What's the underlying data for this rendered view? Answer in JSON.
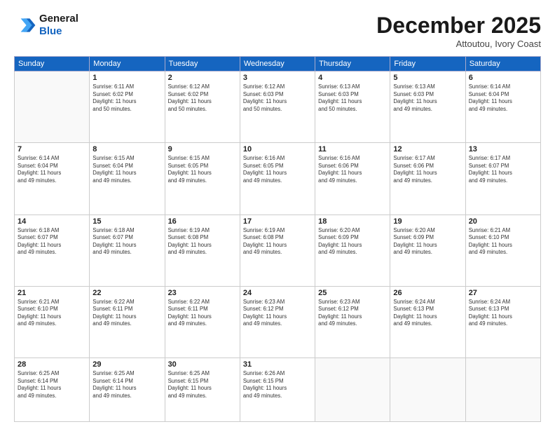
{
  "logo": {
    "line1": "General",
    "line2": "Blue"
  },
  "header": {
    "month": "December 2025",
    "location": "Attoutou, Ivory Coast"
  },
  "weekdays": [
    "Sunday",
    "Monday",
    "Tuesday",
    "Wednesday",
    "Thursday",
    "Friday",
    "Saturday"
  ],
  "weeks": [
    [
      {
        "day": "",
        "info": ""
      },
      {
        "day": "1",
        "info": "Sunrise: 6:11 AM\nSunset: 6:02 PM\nDaylight: 11 hours\nand 50 minutes."
      },
      {
        "day": "2",
        "info": "Sunrise: 6:12 AM\nSunset: 6:02 PM\nDaylight: 11 hours\nand 50 minutes."
      },
      {
        "day": "3",
        "info": "Sunrise: 6:12 AM\nSunset: 6:03 PM\nDaylight: 11 hours\nand 50 minutes."
      },
      {
        "day": "4",
        "info": "Sunrise: 6:13 AM\nSunset: 6:03 PM\nDaylight: 11 hours\nand 50 minutes."
      },
      {
        "day": "5",
        "info": "Sunrise: 6:13 AM\nSunset: 6:03 PM\nDaylight: 11 hours\nand 49 minutes."
      },
      {
        "day": "6",
        "info": "Sunrise: 6:14 AM\nSunset: 6:04 PM\nDaylight: 11 hours\nand 49 minutes."
      }
    ],
    [
      {
        "day": "7",
        "info": "Sunrise: 6:14 AM\nSunset: 6:04 PM\nDaylight: 11 hours\nand 49 minutes."
      },
      {
        "day": "8",
        "info": "Sunrise: 6:15 AM\nSunset: 6:04 PM\nDaylight: 11 hours\nand 49 minutes."
      },
      {
        "day": "9",
        "info": "Sunrise: 6:15 AM\nSunset: 6:05 PM\nDaylight: 11 hours\nand 49 minutes."
      },
      {
        "day": "10",
        "info": "Sunrise: 6:16 AM\nSunset: 6:05 PM\nDaylight: 11 hours\nand 49 minutes."
      },
      {
        "day": "11",
        "info": "Sunrise: 6:16 AM\nSunset: 6:06 PM\nDaylight: 11 hours\nand 49 minutes."
      },
      {
        "day": "12",
        "info": "Sunrise: 6:17 AM\nSunset: 6:06 PM\nDaylight: 11 hours\nand 49 minutes."
      },
      {
        "day": "13",
        "info": "Sunrise: 6:17 AM\nSunset: 6:07 PM\nDaylight: 11 hours\nand 49 minutes."
      }
    ],
    [
      {
        "day": "14",
        "info": "Sunrise: 6:18 AM\nSunset: 6:07 PM\nDaylight: 11 hours\nand 49 minutes."
      },
      {
        "day": "15",
        "info": "Sunrise: 6:18 AM\nSunset: 6:07 PM\nDaylight: 11 hours\nand 49 minutes."
      },
      {
        "day": "16",
        "info": "Sunrise: 6:19 AM\nSunset: 6:08 PM\nDaylight: 11 hours\nand 49 minutes."
      },
      {
        "day": "17",
        "info": "Sunrise: 6:19 AM\nSunset: 6:08 PM\nDaylight: 11 hours\nand 49 minutes."
      },
      {
        "day": "18",
        "info": "Sunrise: 6:20 AM\nSunset: 6:09 PM\nDaylight: 11 hours\nand 49 minutes."
      },
      {
        "day": "19",
        "info": "Sunrise: 6:20 AM\nSunset: 6:09 PM\nDaylight: 11 hours\nand 49 minutes."
      },
      {
        "day": "20",
        "info": "Sunrise: 6:21 AM\nSunset: 6:10 PM\nDaylight: 11 hours\nand 49 minutes."
      }
    ],
    [
      {
        "day": "21",
        "info": "Sunrise: 6:21 AM\nSunset: 6:10 PM\nDaylight: 11 hours\nand 49 minutes."
      },
      {
        "day": "22",
        "info": "Sunrise: 6:22 AM\nSunset: 6:11 PM\nDaylight: 11 hours\nand 49 minutes."
      },
      {
        "day": "23",
        "info": "Sunrise: 6:22 AM\nSunset: 6:11 PM\nDaylight: 11 hours\nand 49 minutes."
      },
      {
        "day": "24",
        "info": "Sunrise: 6:23 AM\nSunset: 6:12 PM\nDaylight: 11 hours\nand 49 minutes."
      },
      {
        "day": "25",
        "info": "Sunrise: 6:23 AM\nSunset: 6:12 PM\nDaylight: 11 hours\nand 49 minutes."
      },
      {
        "day": "26",
        "info": "Sunrise: 6:24 AM\nSunset: 6:13 PM\nDaylight: 11 hours\nand 49 minutes."
      },
      {
        "day": "27",
        "info": "Sunrise: 6:24 AM\nSunset: 6:13 PM\nDaylight: 11 hours\nand 49 minutes."
      }
    ],
    [
      {
        "day": "28",
        "info": "Sunrise: 6:25 AM\nSunset: 6:14 PM\nDaylight: 11 hours\nand 49 minutes."
      },
      {
        "day": "29",
        "info": "Sunrise: 6:25 AM\nSunset: 6:14 PM\nDaylight: 11 hours\nand 49 minutes."
      },
      {
        "day": "30",
        "info": "Sunrise: 6:25 AM\nSunset: 6:15 PM\nDaylight: 11 hours\nand 49 minutes."
      },
      {
        "day": "31",
        "info": "Sunrise: 6:26 AM\nSunset: 6:15 PM\nDaylight: 11 hours\nand 49 minutes."
      },
      {
        "day": "",
        "info": ""
      },
      {
        "day": "",
        "info": ""
      },
      {
        "day": "",
        "info": ""
      }
    ]
  ]
}
